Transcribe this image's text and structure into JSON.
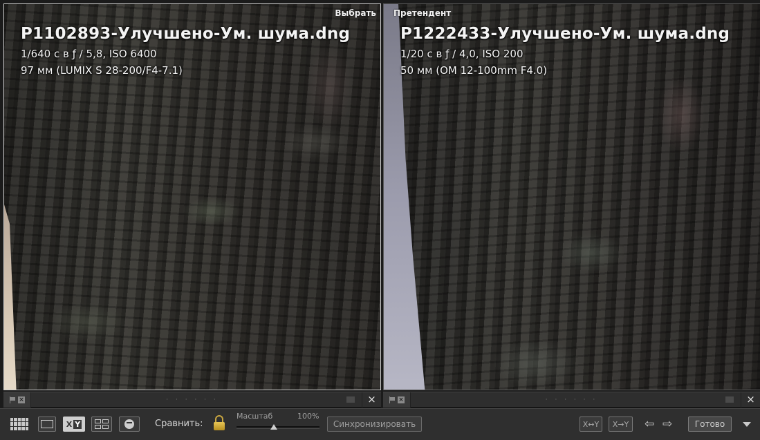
{
  "panes": {
    "select": {
      "tag": "Выбрать",
      "filename": "P1102893-Улучшено-Ум. шума.dng",
      "exposure": "1/640 с в ƒ / 5,8, ISO 6400",
      "lens": "97 мм (LUMIX S 28-200/F4-7.1)"
    },
    "candidate": {
      "tag": "Претендент",
      "filename": "P1222433-Улучшено-Ум. шума.dng",
      "exposure": "1/20 с в ƒ / 4,0, ISO 200",
      "lens": "50 мм (OM 12-100mm F4.0)"
    }
  },
  "strips": {
    "reject_glyph": "×",
    "dots": "· · · · · ·",
    "close_glyph": "×"
  },
  "toolbar": {
    "compare_btn_x": "X",
    "compare_btn_y": "Y",
    "compare_label": "Сравнить:",
    "zoom_label": "Масштаб",
    "zoom_value": "100%",
    "zoom_level": 0.45,
    "sync_label": "Синхронизировать",
    "swap_label": "X↔Y",
    "promote_label": "X→Y",
    "prev_glyph": "⇦",
    "next_glyph": "⇨",
    "done_label": "Готово"
  },
  "colors": {
    "background": "#1b1b1b",
    "toolbar": "#2f2f2f",
    "lock": "#c9a640"
  },
  "icons": [
    "grid-view-icon",
    "loupe-view-icon",
    "compare-view-icon",
    "survey-view-icon",
    "people-view-icon",
    "lock-icon",
    "flag-icon",
    "reject-flag-icon",
    "close-icon",
    "swap-icon",
    "promote-icon",
    "arrow-left-icon",
    "arrow-right-icon",
    "dropdown-triangle-icon"
  ]
}
